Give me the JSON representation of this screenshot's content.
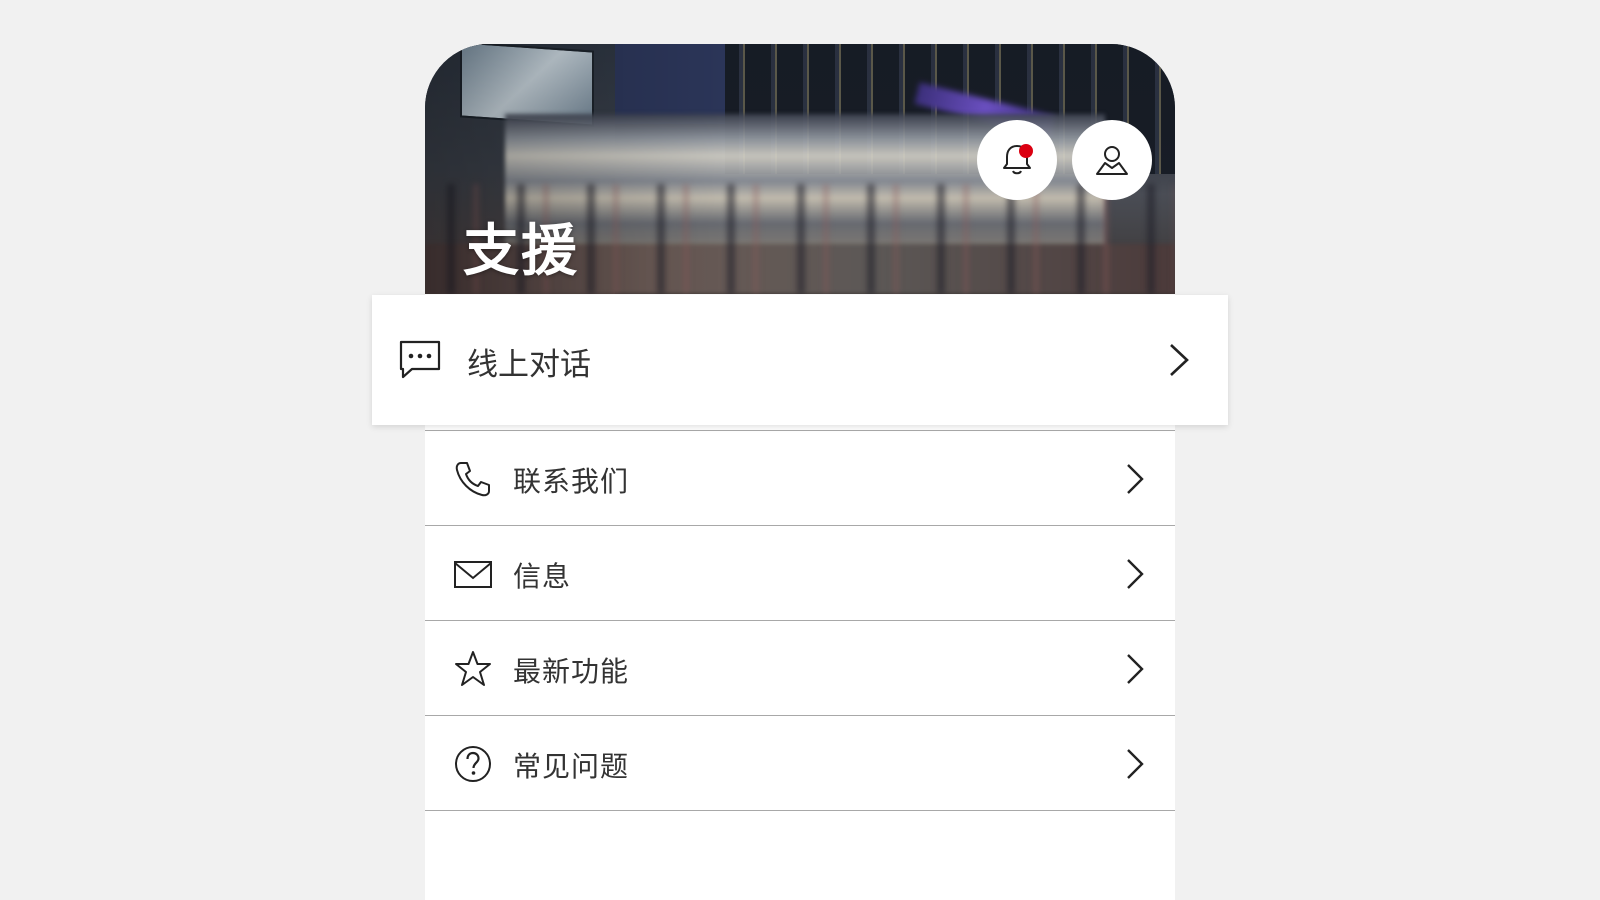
{
  "header": {
    "title": "支援",
    "notifications_icon": "bell-icon",
    "notification_dot_color": "#db0011",
    "profile_icon": "user-icon"
  },
  "featured_item": {
    "label": "线上对话",
    "icon": "chat-icon"
  },
  "menu": {
    "items": [
      {
        "label": "联系我们",
        "icon": "phone-icon"
      },
      {
        "label": "信息",
        "icon": "mail-icon"
      },
      {
        "label": "最新功能",
        "icon": "star-icon"
      },
      {
        "label": "常见问题",
        "icon": "help-icon"
      }
    ]
  },
  "colors": {
    "background": "#f1f1f1",
    "surface": "#ffffff",
    "text": "#333333",
    "divider": "#a8a8a8",
    "accent": "#db0011"
  }
}
